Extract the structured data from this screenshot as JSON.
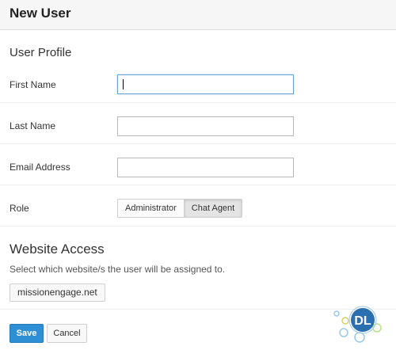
{
  "header": {
    "title": "New User"
  },
  "profile": {
    "section_title": "User Profile",
    "first_name": {
      "label": "First Name",
      "value": ""
    },
    "last_name": {
      "label": "Last Name",
      "value": ""
    },
    "email": {
      "label": "Email Address",
      "value": ""
    },
    "role": {
      "label": "Role",
      "options": [
        "Administrator",
        "Chat Agent"
      ],
      "selected": "Chat Agent"
    }
  },
  "website_access": {
    "title": "Website Access",
    "description": "Select which website/s the user will be assigned to.",
    "sites": [
      "missionengage.net"
    ]
  },
  "actions": {
    "save_label": "Save",
    "cancel_label": "Cancel"
  },
  "watermark": {
    "text": "DL"
  },
  "colors": {
    "primary": "#2f8fd5",
    "focus_border": "#6aa3d8",
    "watermark": "#2a6fb0"
  }
}
